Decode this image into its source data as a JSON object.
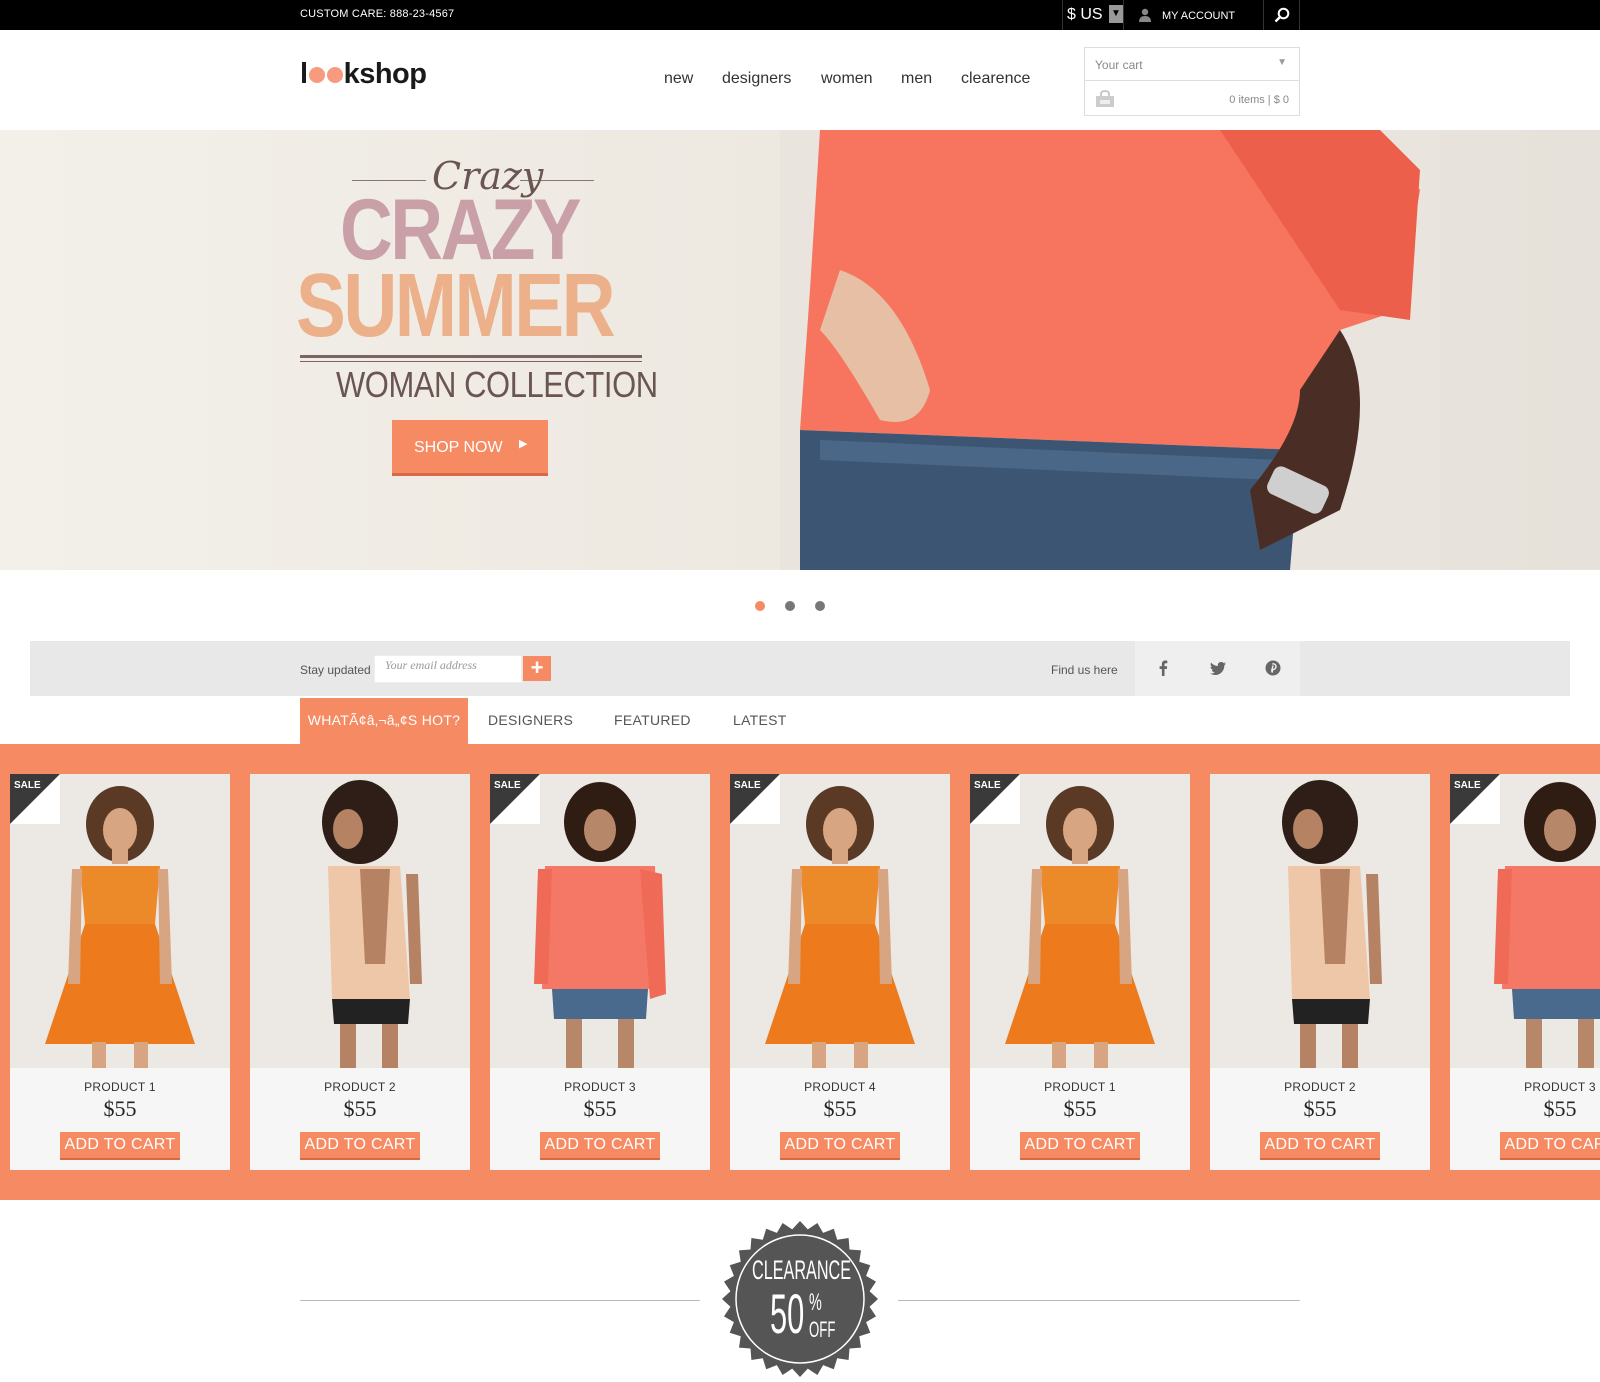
{
  "topbar": {
    "custom_care": "CUSTOM CARE: 888-23-4567",
    "currency": "$ US",
    "account_label": "MY ACCOUNT"
  },
  "header": {
    "logo_prefix": "l",
    "logo_suffix": "kshop",
    "nav": [
      "new",
      "designers",
      "women",
      "men",
      "clearence"
    ],
    "cart": {
      "label": "Your cart",
      "summary": "0 items | $ 0"
    }
  },
  "hero": {
    "script": "Crazy",
    "headline_1": "CRAZY",
    "headline_2": "SUMMER",
    "subheadline": "WOMAN COLLECTION",
    "cta_label": "SHOP NOW"
  },
  "slider": {
    "active_index": 0,
    "count": 3
  },
  "newsletter": {
    "label": "Stay updated",
    "email_placeholder": "Your email address",
    "find_us": "Find us here"
  },
  "tabs": [
    "WHATÃ¢â‚¬â„¢S HOT?",
    "DESIGNERS",
    "FEATURED",
    "LATEST"
  ],
  "products": [
    {
      "name": "PRODUCT 1",
      "price": "$55",
      "button": "ADD TO CART",
      "sale": true,
      "sale_label": "SALE",
      "style": "orange-dress"
    },
    {
      "name": "PRODUCT 2",
      "price": "$55",
      "button": "ADD TO CART",
      "sale": false,
      "sale_label": "",
      "style": "backless-top"
    },
    {
      "name": "PRODUCT 3",
      "price": "$55",
      "button": "ADD TO CART",
      "sale": true,
      "sale_label": "SALE",
      "style": "coral-tee"
    },
    {
      "name": "PRODUCT 4",
      "price": "$55",
      "button": "ADD TO CART",
      "sale": true,
      "sale_label": "SALE",
      "style": "orange-dress"
    },
    {
      "name": "PRODUCT 1",
      "price": "$55",
      "button": "ADD TO CART",
      "sale": true,
      "sale_label": "SALE",
      "style": "orange-dress"
    },
    {
      "name": "PRODUCT 2",
      "price": "$55",
      "button": "ADD TO CART",
      "sale": false,
      "sale_label": "",
      "style": "backless-top"
    },
    {
      "name": "PRODUCT 3",
      "price": "$55",
      "button": "ADD TO CART",
      "sale": true,
      "sale_label": "SALE",
      "style": "coral-tee"
    }
  ],
  "clearance": {
    "word": "CLEARANCE",
    "number": "50",
    "percent": "%",
    "off": "OFF"
  },
  "colors": {
    "accent": "#f68b63",
    "topbar": "#000000",
    "badge": "#555555"
  }
}
